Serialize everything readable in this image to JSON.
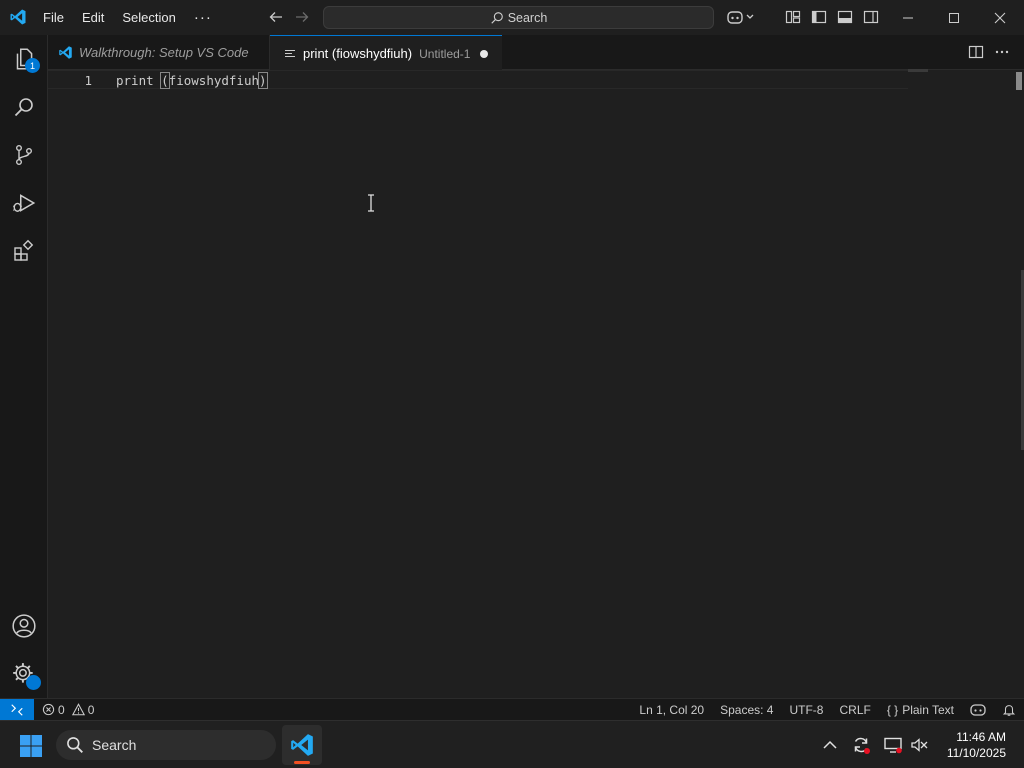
{
  "titlebar": {
    "menu": [
      "File",
      "Edit",
      "Selection"
    ],
    "more": "···",
    "search_label": "Search"
  },
  "activity_bar": {
    "explorer_badge": "1"
  },
  "tabs": [
    {
      "label": "Walkthrough: Setup VS Code",
      "description": ""
    },
    {
      "label": "print (fiowshydfiuh)",
      "description": "Untitled-1"
    }
  ],
  "editor": {
    "line_number": "1",
    "code_before": "print ",
    "code_open": "(",
    "code_mid": "fiowshydfiuh",
    "code_close": ")"
  },
  "statusbar": {
    "errors": "0",
    "warnings": "0",
    "position": "Ln 1, Col 20",
    "spaces": "Spaces: 4",
    "encoding": "UTF-8",
    "eol": "CRLF",
    "language": "Plain Text",
    "language_icon": "{ }"
  },
  "taskbar": {
    "search_label": "Search",
    "time": "11:46 AM",
    "date": "11/10/2025"
  },
  "colors": {
    "accent": "#0078d4",
    "background": "#1f1f1f",
    "sidebar": "#181818"
  }
}
